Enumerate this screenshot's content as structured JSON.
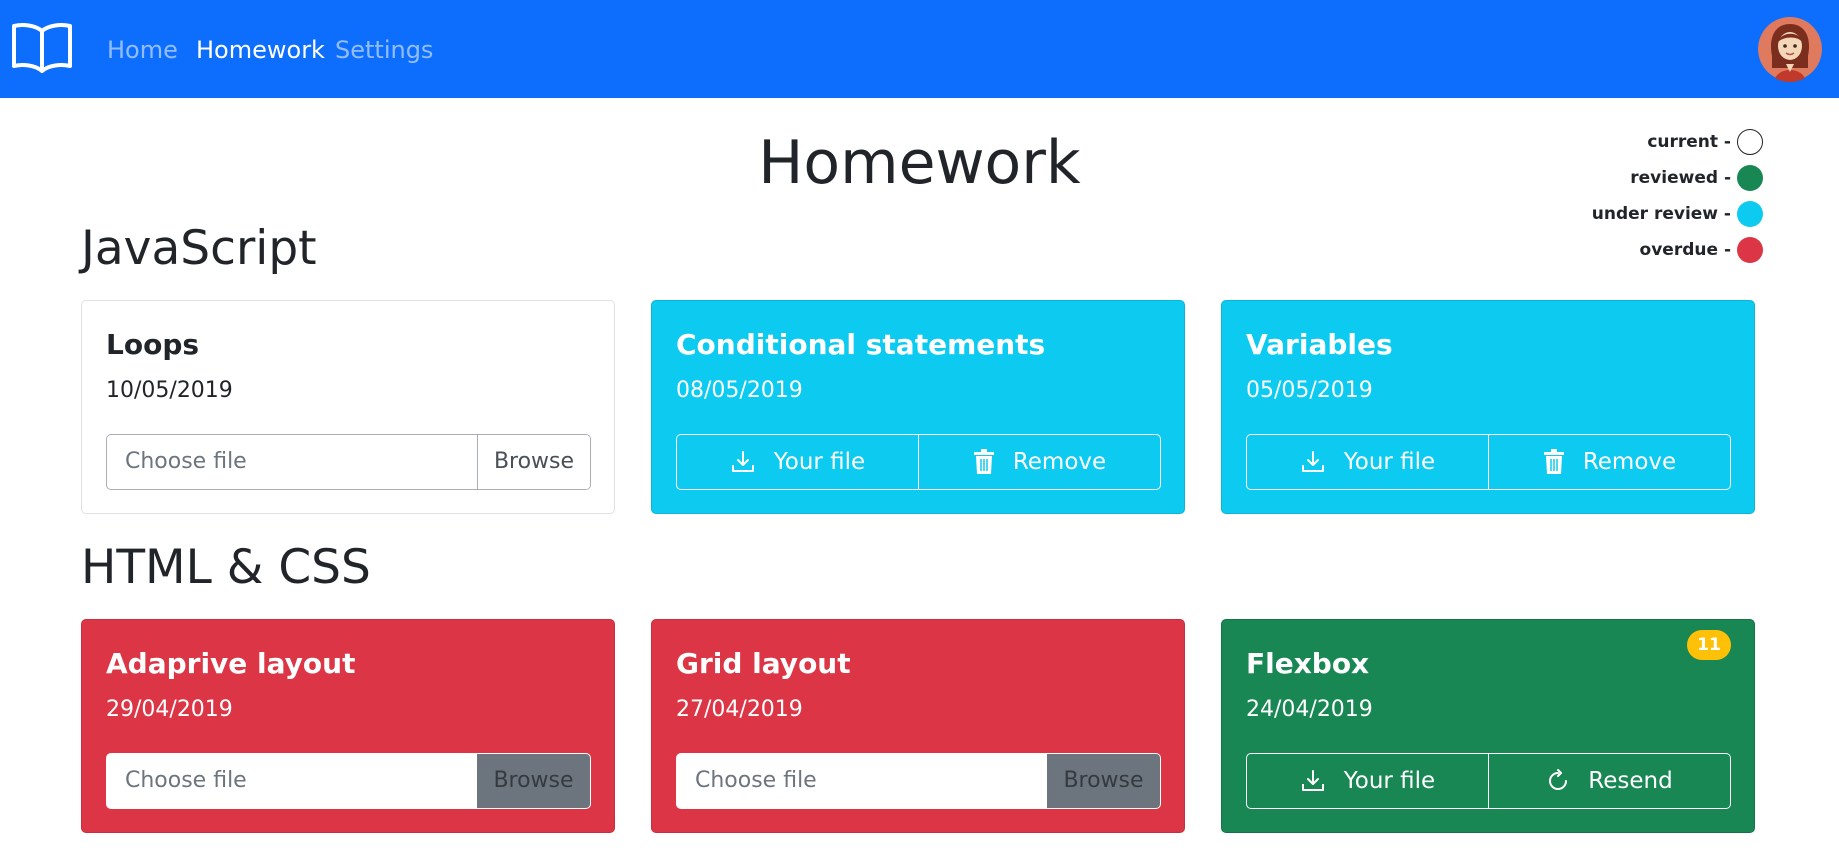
{
  "nav": {
    "links": [
      {
        "label": "Home"
      },
      {
        "label": "Homework"
      },
      {
        "label": "Settings"
      }
    ]
  },
  "page_title": "Homework",
  "legend": [
    {
      "label": "current -",
      "color": "#ffffff"
    },
    {
      "label": "reviewed -",
      "color": "#198754"
    },
    {
      "label": "under review -",
      "color": "#0dcaf0"
    },
    {
      "label": "overdue -",
      "color": "#dc3545"
    }
  ],
  "sections": [
    {
      "title": "JavaScript",
      "cards": [
        {
          "title": "Loops",
          "date": "10/05/2019",
          "status": "current",
          "file_placeholder": "Choose file",
          "browse_label": "Browse"
        },
        {
          "title": "Conditional statements",
          "date": "08/05/2019",
          "status": "under review",
          "file_label": "Your file",
          "action_label": "Remove"
        },
        {
          "title": "Variables",
          "date": "05/05/2019",
          "status": "under review",
          "file_label": "Your file",
          "action_label": "Remove"
        }
      ]
    },
    {
      "title": "HTML & CSS",
      "cards": [
        {
          "title": "Adaprive layout",
          "date": "29/04/2019",
          "status": "overdue",
          "file_placeholder": "Choose file",
          "browse_label": "Browse"
        },
        {
          "title": "Grid layout",
          "date": "27/04/2019",
          "status": "overdue",
          "file_placeholder": "Choose file",
          "browse_label": "Browse"
        },
        {
          "title": "Flexbox",
          "date": "24/04/2019",
          "status": "reviewed",
          "badge": "11",
          "file_label": "Your file",
          "action_label": "Resend"
        }
      ]
    }
  ],
  "colors": {
    "navbar": "#0d6efd",
    "current": "#ffffff",
    "reviewed": "#198754",
    "under_review": "#0dcaf0",
    "overdue": "#dc3545",
    "badge": "#ffc107"
  }
}
